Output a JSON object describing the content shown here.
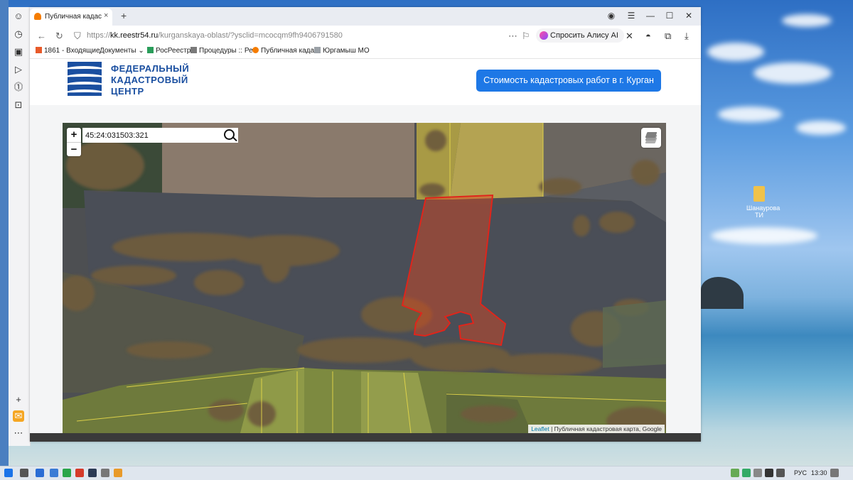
{
  "browser": {
    "tab_title": "Публичная кадастровая",
    "tab_close": "×",
    "new_tab": "+",
    "url_scheme": "https://",
    "url_host": "kk.reestr54.ru",
    "url_path": "/kurganskaya-oblast/?ysclid=mcocqm9fh9406791580",
    "alice_button": "Спросить Алису AI",
    "bookmarks": [
      {
        "label": "1861 - Входящие",
        "icon": "mail-icon",
        "color": "#e85a2a"
      },
      {
        "label": "Документы",
        "icon": "folder-icon",
        "color": "#ffffff"
      },
      {
        "label": "РосРеестр",
        "icon": "rosreestr-icon",
        "color": "#2a9d5a"
      },
      {
        "label": "Процедуры :: Ре",
        "icon": "procedures-icon",
        "color": "#7a7a7a"
      },
      {
        "label": "Публичная кадас",
        "icon": "orange-house-icon",
        "color": "#f57c00"
      },
      {
        "label": "Юргамыш МО",
        "icon": "page-icon",
        "color": "#9aa0a6"
      }
    ],
    "documents_chevron": "⌄"
  },
  "site": {
    "logo_text": [
      "ФЕДЕРАЛЬНЫЙ",
      "КАДАСТРОВЫЙ",
      "ЦЕНТР"
    ],
    "cta_button": "Стоимость кадастровых работ в г. Курган",
    "brand_color": "#1a4fa0",
    "cta_color": "#1e78e6"
  },
  "map": {
    "search_value": "45:24:031503:321",
    "zoom_in": "+",
    "zoom_out": "−",
    "attribution_link": "Leaflet",
    "attribution_text": " | Публичная кадастровая карта, Google",
    "parcel_color": "#e0251b"
  },
  "desktop": {
    "icon_label": "Шанаурова ТИ"
  },
  "taskbar": {
    "lang": "РУС",
    "time": "13:30"
  }
}
